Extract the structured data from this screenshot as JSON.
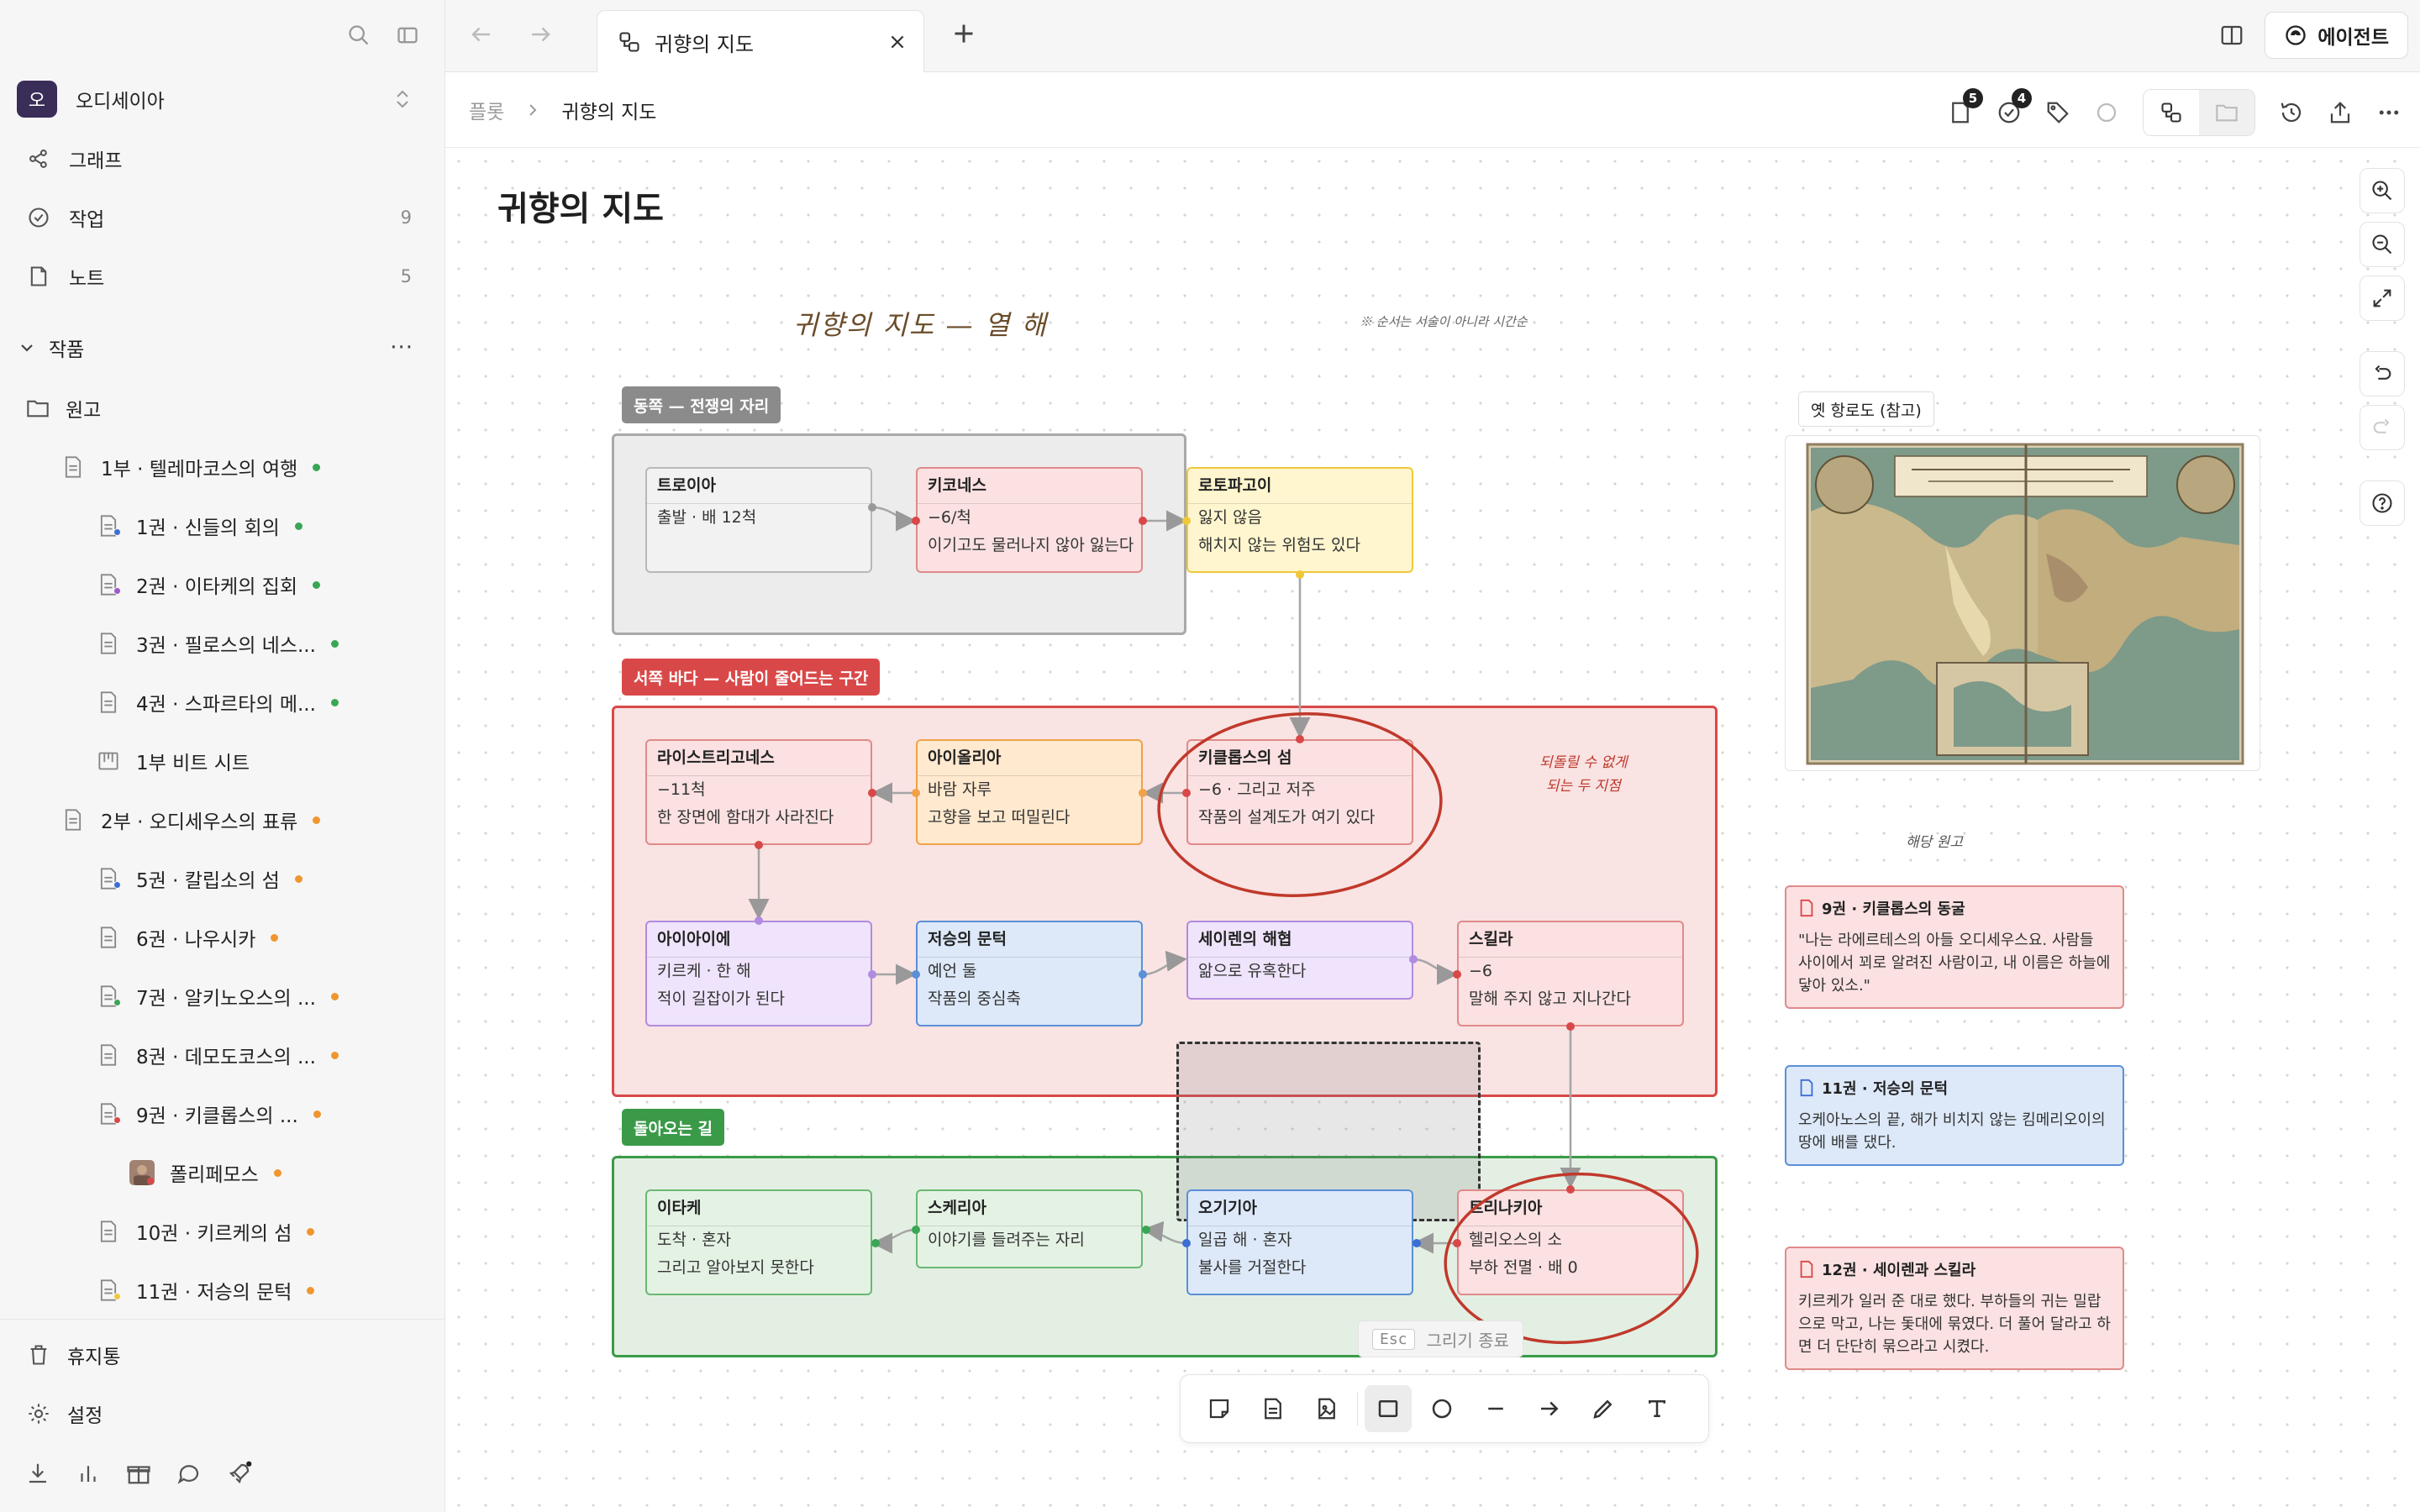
{
  "sidebar": {
    "workspace": {
      "initial": "오",
      "name": "오디세이아"
    },
    "nav": [
      {
        "label": "그래프",
        "count": ""
      },
      {
        "label": "작업",
        "count": "9"
      },
      {
        "label": "노트",
        "count": "5"
      }
    ],
    "section": {
      "label": "작품",
      "more": "···"
    },
    "tree": [
      {
        "label": "원고",
        "dot": ""
      },
      {
        "label": "1부 · 텔레마코스의 여행",
        "dot": "#3aa655"
      },
      {
        "label": "1권 · 신들의 회의",
        "dot": "#3aa655"
      },
      {
        "label": "2권 · 이타케의 집회",
        "dot": "#3aa655"
      },
      {
        "label": "3권 · 필로스의 네스...",
        "dot": "#3aa655"
      },
      {
        "label": "4권 · 스파르타의 메...",
        "dot": "#3aa655"
      },
      {
        "label": "1부 비트 시트",
        "dot": ""
      },
      {
        "label": "2부 · 오디세우스의 표류",
        "dot": "#f0962e"
      },
      {
        "label": "5권 · 칼립소의 섬",
        "dot": "#f0962e"
      },
      {
        "label": "6권 · 나우시카",
        "dot": "#f0962e"
      },
      {
        "label": "7권 · 알키노오스의 ...",
        "dot": "#f0962e"
      },
      {
        "label": "8권 · 데모도코스의 ...",
        "dot": "#f0962e"
      },
      {
        "label": "9권 · 키클롭스의 ...",
        "dot": "#f0962e"
      },
      {
        "label": "폴리페모스",
        "dot": "#f0962e"
      },
      {
        "label": "10권 · 키르케의 섬",
        "dot": "#f0962e"
      },
      {
        "label": "11권 · 저승의 문턱",
        "dot": "#f0962e"
      }
    ],
    "bottom": [
      {
        "label": "휴지통"
      },
      {
        "label": "설정"
      }
    ]
  },
  "tabbar": {
    "tab_title": "귀향의 지도",
    "agent_label": "에이전트"
  },
  "header": {
    "crumb_parent": "플롯",
    "crumb_current": "귀향의 지도",
    "files_badge": "5",
    "tasks_badge": "4"
  },
  "canvas": {
    "page_title": "귀향의 지도",
    "handwriting": {
      "title": "귀향의 지도 — 열 해",
      "note": "※ 순서는 서술이 아니라 시간순",
      "red_note_1": "되돌릴 수 없게",
      "red_note_2": "되는 두 지점",
      "ref_note": "해당 원고"
    },
    "groups": [
      {
        "label": "동쪽 — 전쟁의 자리"
      },
      {
        "label": "서쪽 바다 — 사람이 줄어드는 구간"
      },
      {
        "label": "돌아오는 길"
      }
    ],
    "nodes": [
      {
        "title": "트로이아",
        "lines": [
          "출발 · 배 12척"
        ]
      },
      {
        "title": "키코네스",
        "lines": [
          "−6/척",
          "이기고도 물러나지 않아 잃는다"
        ]
      },
      {
        "title": "로토파고이",
        "lines": [
          "잃지 않음",
          "해치지 않는 위험도 있다"
        ]
      },
      {
        "title": "라이스트리고네스",
        "lines": [
          "−11척",
          "한 장면에 함대가 사라진다"
        ]
      },
      {
        "title": "아이올리아",
        "lines": [
          "바람 자루",
          "고향을 보고 떠밀린다"
        ]
      },
      {
        "title": "키클롭스의 섬",
        "lines": [
          "−6 · 그리고 저주",
          "작품의 설계도가 여기 있다"
        ]
      },
      {
        "title": "아이아이에",
        "lines": [
          "키르케 · 한 해",
          "적이 길잡이가 된다"
        ]
      },
      {
        "title": "저승의 문턱",
        "lines": [
          "예언 둘",
          "작품의 중심축"
        ]
      },
      {
        "title": "세이렌의 해협",
        "lines": [
          "앎으로 유혹한다"
        ]
      },
      {
        "title": "스킬라",
        "lines": [
          "−6",
          "말해 주지 않고 지나간다"
        ]
      },
      {
        "title": "이타케",
        "lines": [
          "도착 · 혼자",
          "그리고 알아보지 못한다"
        ]
      },
      {
        "title": "스케리아",
        "lines": [
          "이야기를 들려주는 자리"
        ]
      },
      {
        "title": "오기기아",
        "lines": [
          "일곱 해 · 혼자",
          "불사를 거절한다"
        ]
      },
      {
        "title": "트리나키아",
        "lines": [
          "헬리오스의 소",
          "부하 전멸 · 배 0"
        ]
      }
    ],
    "reference": {
      "label": "옛 항로도 (참고)"
    },
    "notes": [
      {
        "title": "9권 · 키클롭스의 동굴",
        "body": "\"나는 라에르테스의 아들 오디세우스요. 사람들 사이에서 꾀로 알려진 사람이고, 내 이름은 하늘에 닿아 있소.\""
      },
      {
        "title": "11권 · 저승의 문턱",
        "body": "오케아노스의 끝, 해가 비치지 않는 킴메리오이의 땅에 배를 댔다."
      },
      {
        "title": "12권 · 세이렌과 스킬라",
        "body": "키르케가 일러 준 대로 했다. 부하들의 귀는 밀랍으로 막고, 나는 돛대에 묶였다. 더 풀어 달라고 하면 더 단단히 묶으라고 시켰다."
      }
    ],
    "draw_hint": {
      "key": "Esc",
      "label": "그리기 종료"
    }
  },
  "colors": {
    "accent_red": "#d94848",
    "accent_green": "#3a9a48",
    "dot_green": "#3aa655",
    "dot_orange": "#f0962e",
    "workspace_avatar": "#3a2d57"
  }
}
